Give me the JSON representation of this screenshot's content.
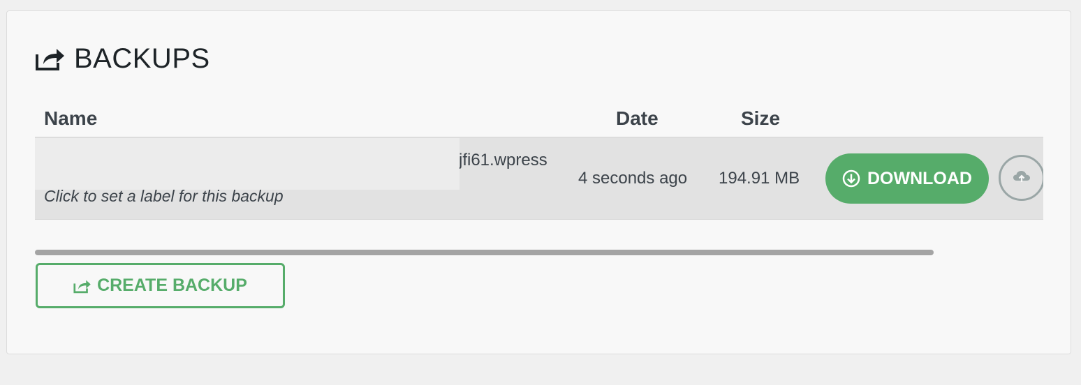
{
  "header": {
    "title": "BACKUPS",
    "icon": "share-export-icon"
  },
  "table": {
    "columns": [
      "Name",
      "Date",
      "Size"
    ],
    "rows": [
      {
        "filename": "jfi61.wpress",
        "label_hint": "Click to set a label for this backup",
        "date": "4 seconds ago",
        "size": "194.91 MB",
        "download_label": "DOWNLOAD"
      }
    ]
  },
  "actions": {
    "create_label": "CREATE BACKUP"
  },
  "colors": {
    "accent_green": "#56ac6a",
    "row_bg": "#e2e2e2",
    "scrollbar": "#a4a4a4"
  }
}
